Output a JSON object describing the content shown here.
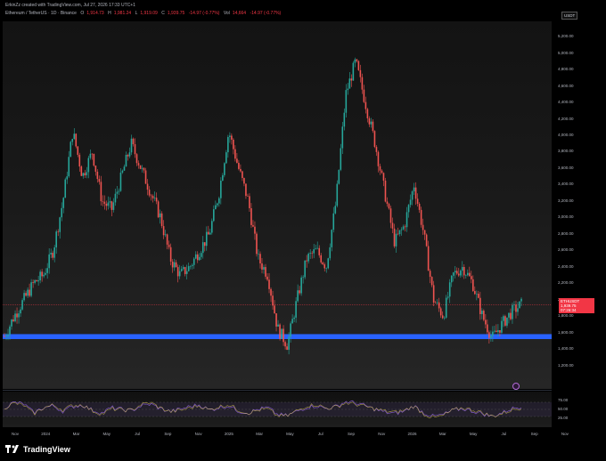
{
  "header": {
    "credit": "ErkinZz created with TradingView.com, Jul 27, 2026 17:33 UTC+1",
    "symbol": "Ethereum / TetherUS · 1D · Binance",
    "o_label": "O",
    "o_value": "1,914.73",
    "h_label": "H",
    "h_value": "1,981.24",
    "l_label": "L",
    "l_value": "1,919.09",
    "c_label": "C",
    "c_value": "1,939.75",
    "change": "-14.97 (-0.77%)",
    "vol_label": "Vol",
    "vol_value": "14,664",
    "vol_change": "-14.97 (-0.77%)"
  },
  "currency": "USDT",
  "price_axis": [
    "5,200.00",
    "5,000.00",
    "4,800.00",
    "4,600.00",
    "4,400.00",
    "4,200.00",
    "4,000.00",
    "3,800.00",
    "3,600.00",
    "3,400.00",
    "3,200.00",
    "3,000.00",
    "2,800.00",
    "2,600.00",
    "2,400.00",
    "2,200.00",
    "2,000.00",
    "1,800.00",
    "1,600.00",
    "1,400.00",
    "1,200.00"
  ],
  "price_label": {
    "symbol": "ETHUSDT",
    "price": "1,939.75",
    "countdown": "07:26:34"
  },
  "osc_axis": [
    "75.00",
    "50.00",
    "25.00"
  ],
  "time_axis": [
    "Nov",
    "2024",
    "Mar",
    "May",
    "Jul",
    "Sep",
    "Nov",
    "2025",
    "Mar",
    "May",
    "Jul",
    "Sep",
    "Nov",
    "2026",
    "Mar",
    "May",
    "Jul",
    "Sep",
    "Nov"
  ],
  "footer": {
    "brand": "TradingView"
  },
  "colors": {
    "up": "#26a69a",
    "down": "#ef5350",
    "support": "#2962ff",
    "rsi": "#7e57c2",
    "current": "#f23645"
  },
  "chart_data": {
    "type": "line",
    "ylim": [
      1000,
      5300
    ],
    "support_zone": [
      1520,
      1580
    ],
    "current_price": 1939.75,
    "series": [
      {
        "values": [
          1550,
          1800,
          2000,
          2200,
          2300,
          2600,
          3200,
          4050,
          3500,
          3800,
          3200,
          3100,
          3500,
          3900,
          3600,
          3300,
          3000,
          2500,
          2300,
          2400,
          2600,
          2800,
          3300,
          4050,
          3600,
          3200,
          2500,
          2300,
          1650,
          1450,
          2000,
          2500,
          2600,
          2400,
          3200,
          4500,
          4900,
          4400,
          3900,
          3300,
          2700,
          2900,
          3400,
          2800,
          2000,
          1800,
          2300,
          2400,
          2200,
          1800,
          1530,
          1700,
          1850,
          1940
        ]
      }
    ],
    "rsi_values": [
      55,
      70,
      65,
      40,
      55,
      60,
      45,
      58,
      62,
      48,
      40,
      55,
      50,
      46,
      60,
      65,
      52,
      44,
      50,
      58,
      63,
      48,
      55,
      60,
      45,
      40,
      50,
      55,
      35,
      32,
      45,
      56,
      60,
      52,
      58,
      72,
      68,
      60,
      50,
      42,
      38,
      45,
      60,
      40,
      30,
      35,
      48,
      52,
      45,
      38,
      30,
      40,
      52,
      58
    ]
  }
}
